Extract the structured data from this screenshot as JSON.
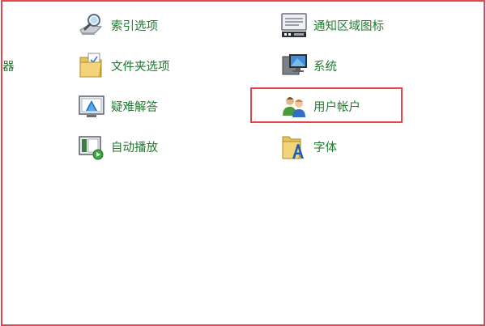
{
  "left_cut_item": {
    "label": "器"
  },
  "items": [
    {
      "label": "索引选项",
      "icon": "indexing-options-icon"
    },
    {
      "label": "通知区域图标",
      "icon": "notification-area-icons-icon"
    },
    {
      "label": "文件夹选项",
      "icon": "folder-options-icon"
    },
    {
      "label": "系统",
      "icon": "system-icon"
    },
    {
      "label": "疑难解答",
      "icon": "troubleshooting-icon"
    },
    {
      "label": "用户帐户",
      "icon": "user-accounts-icon"
    },
    {
      "label": "自动播放",
      "icon": "autoplay-icon"
    },
    {
      "label": "字体",
      "icon": "fonts-icon"
    }
  ],
  "colors": {
    "link_text": "#1e7a2e",
    "annotation_border": "#e0464b"
  }
}
